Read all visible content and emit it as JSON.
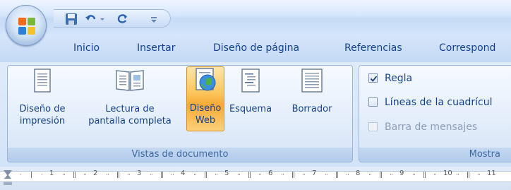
{
  "tabs": [
    "Inicio",
    "Insertar",
    "Diseño de página",
    "Referencias",
    "Correspond"
  ],
  "groups": {
    "vistas": {
      "label": "Vistas de documento",
      "buttons": [
        {
          "line1": "Diseño de",
          "line2": "impresión",
          "icon": "print-layout-icon"
        },
        {
          "line1": "Lectura de",
          "line2": "pantalla completa",
          "icon": "full-screen-reading-icon"
        },
        {
          "line1": "Diseño",
          "line2": "Web",
          "icon": "web-layout-icon",
          "active": true
        },
        {
          "line1": "Esquema",
          "line2": "",
          "icon": "outline-icon"
        },
        {
          "line1": "Borrador",
          "line2": "",
          "icon": "draft-icon"
        }
      ]
    },
    "mostrar": {
      "label": "Mostra",
      "checks": [
        {
          "label": "Regla",
          "checked": true,
          "disabled": false
        },
        {
          "label": "Líneas de la cuadrícul",
          "checked": false,
          "disabled": false
        },
        {
          "label": "Barra de mensajes",
          "checked": false,
          "disabled": true
        }
      ]
    }
  },
  "ruler": {
    "numbers": [
      "1",
      "2",
      "3",
      "4",
      "5",
      "6",
      "7",
      "8",
      "9",
      "10",
      "11"
    ]
  },
  "colors": {
    "accent_text": "#15428b",
    "active_button": "#f7a935",
    "ribbon_bg": "#dfebfa"
  }
}
